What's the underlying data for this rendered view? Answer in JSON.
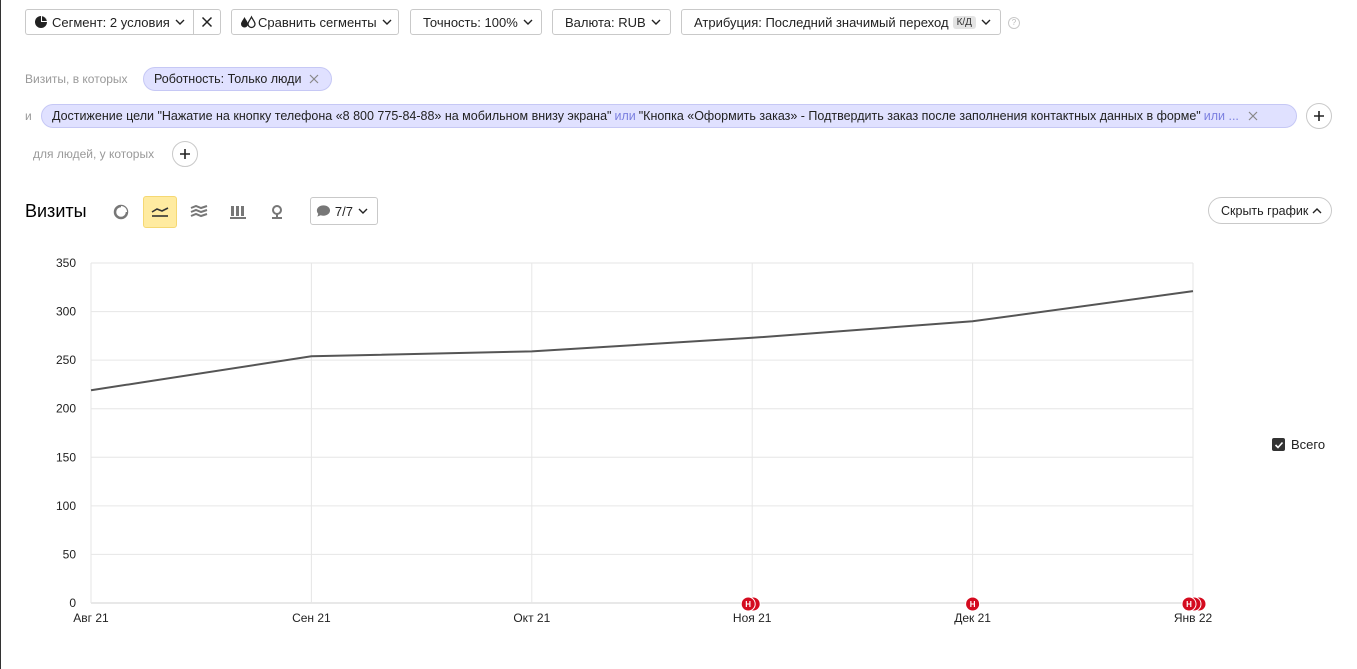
{
  "toolbar": {
    "segment_label": "Сегмент: 2 условия",
    "compare_label": "Сравнить сегменты",
    "accuracy_label": "Точность: 100%",
    "currency_label": "Валюта: RUB",
    "attribution_label": "Атрибуция: Последний значимый переход",
    "attribution_tag": "К/Д",
    "help_glyph": "?"
  },
  "filters": {
    "visits_prefix": "Визиты, в которых",
    "robot_pill": "Роботность: Только люди",
    "and_label": "и",
    "goal_part1": "Достижение цели \"Нажатие на кнопку телефона «8 800 775-84-88» на мобильном внизу экрана\"",
    "or1": "или",
    "goal_part2": "\"Кнопка «Оформить заказ» - Подтвердить заказ после заполнения контактных данных в форме\"",
    "or2": "или ...",
    "people_label": "для людей, у которых"
  },
  "chart_header": {
    "title": "Визиты",
    "annotations_label": "7/7",
    "hide_chart_label": "Скрыть график"
  },
  "legend": {
    "total_label": "Всего"
  },
  "colors": {
    "line": "#555555",
    "marker": "#d40b1f",
    "grid": "#e6e6e6",
    "active_tab": "#ffeba0"
  },
  "chart_data": {
    "type": "line",
    "categories": [
      "Авг 21",
      "Сен 21",
      "Окт 21",
      "Ноя 21",
      "Дек 21",
      "Янв 22"
    ],
    "series": [
      {
        "name": "Всего",
        "values": [
          219,
          254,
          259,
          273,
          290,
          321
        ]
      }
    ],
    "ylim": [
      0,
      350
    ],
    "yticks": [
      0,
      50,
      100,
      150,
      200,
      250,
      300,
      350
    ],
    "xlabel": "",
    "ylabel": "",
    "grid": true,
    "legend": "right",
    "markers": [
      {
        "at": 3,
        "label": "Н",
        "count": 2
      },
      {
        "at": 4,
        "label": "Н",
        "count": 1
      },
      {
        "at": 5,
        "label": "Н",
        "count": 3
      }
    ]
  }
}
